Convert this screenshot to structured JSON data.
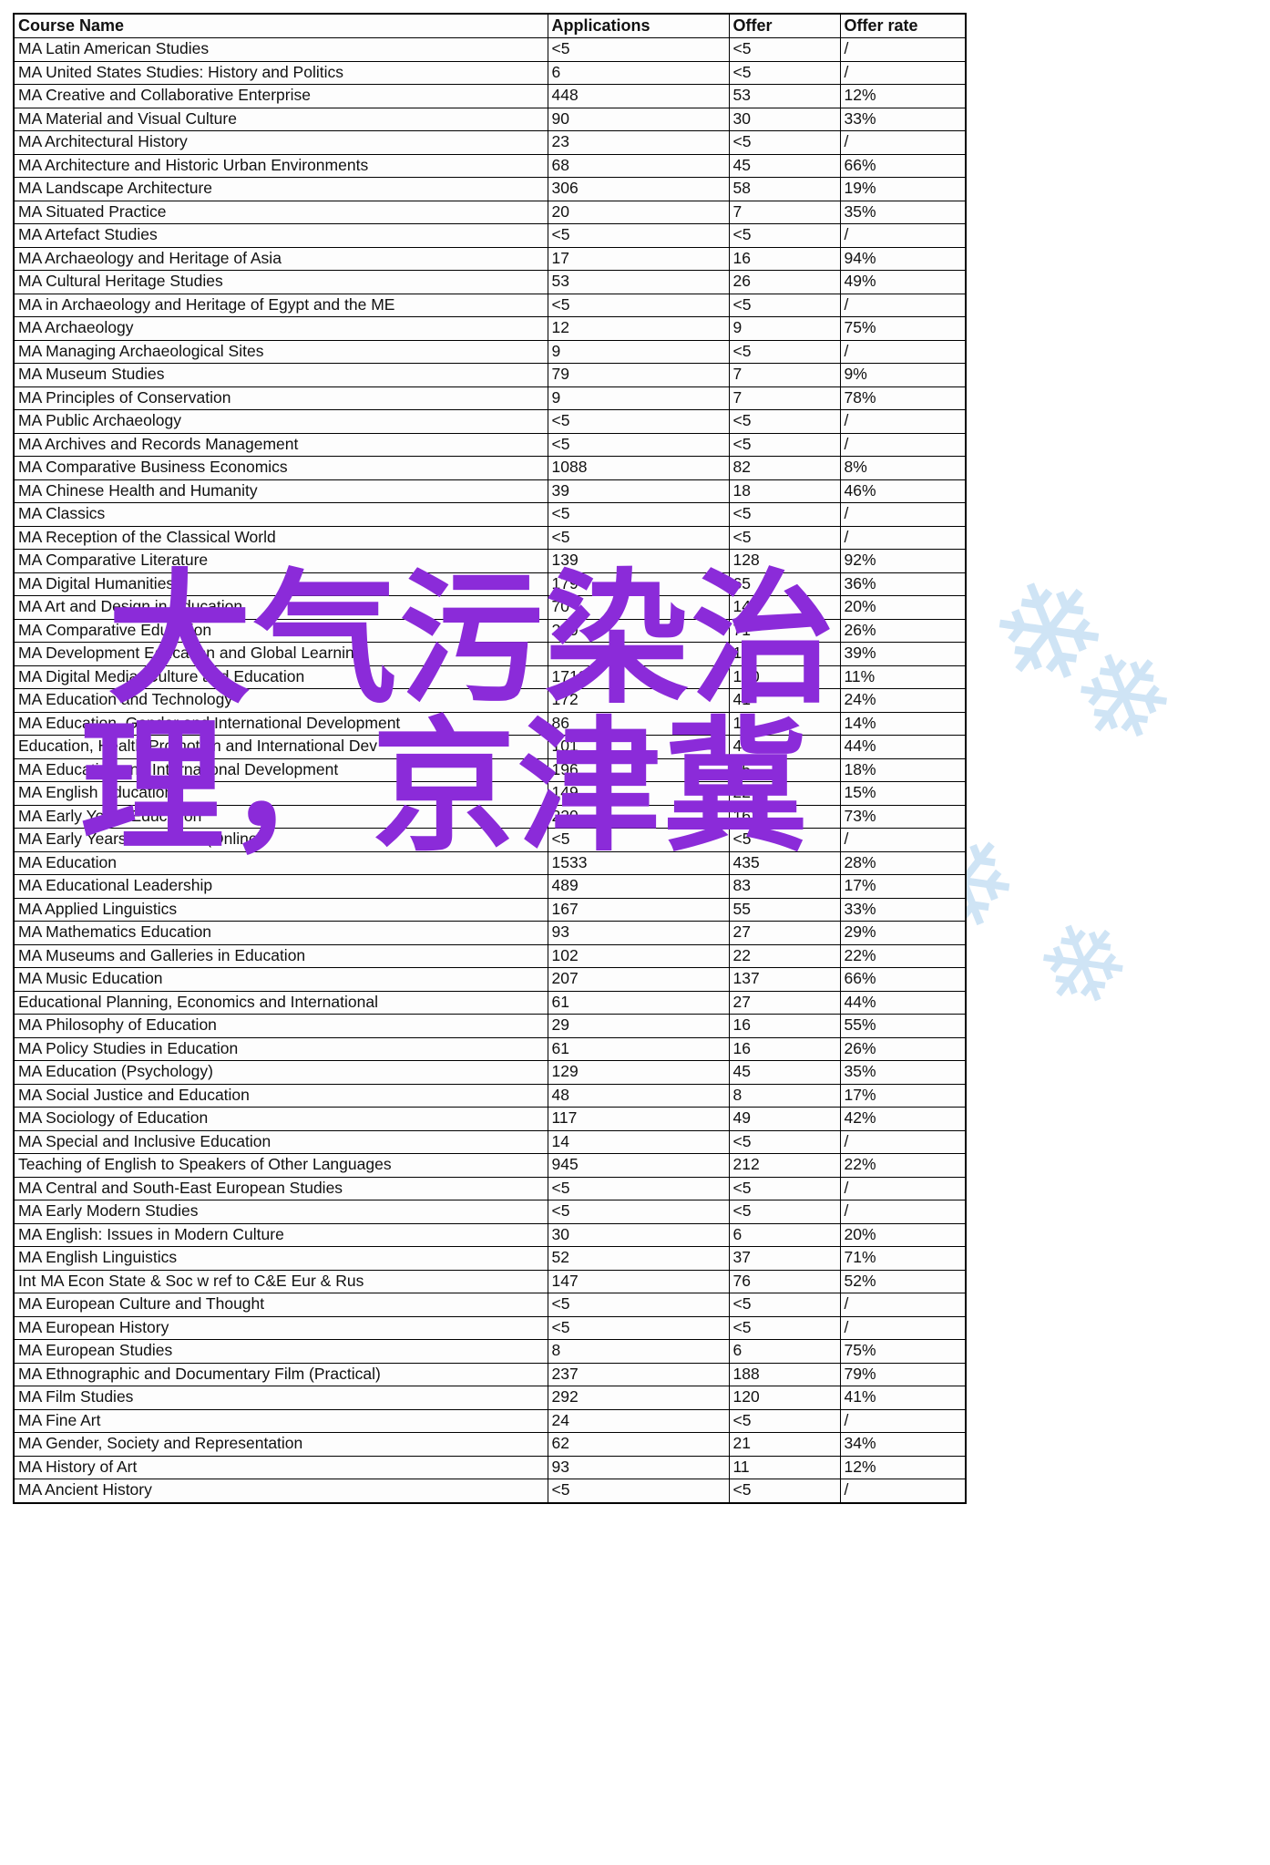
{
  "watermark": {
    "purple_color": "#8B2BD9",
    "bg_color": "#cfe4f5",
    "line1": "大气污染治",
    "line2": "理，京津冀",
    "bg_glyphs": [
      "❄",
      "❄",
      "❄",
      "❄",
      "❄",
      "❄",
      "❄",
      "❄",
      "❄",
      "❄"
    ]
  },
  "table": {
    "columns": [
      "Course Name",
      "Applications",
      "Offer",
      "Offer rate"
    ],
    "rows": [
      [
        "MA Latin American Studies",
        "<5",
        "<5",
        "/"
      ],
      [
        "MA United States Studies: History and Politics",
        "6",
        "<5",
        "/"
      ],
      [
        "MA Creative and Collaborative Enterprise",
        "448",
        "53",
        "12%"
      ],
      [
        "MA Material and Visual Culture",
        "90",
        "30",
        "33%"
      ],
      [
        "MA Architectural History",
        "23",
        "<5",
        "/"
      ],
      [
        "MA Architecture and Historic Urban Environments",
        "68",
        "45",
        "66%"
      ],
      [
        "MA Landscape Architecture",
        "306",
        "58",
        "19%"
      ],
      [
        "MA Situated Practice",
        "20",
        "7",
        "35%"
      ],
      [
        "MA Artefact Studies",
        "<5",
        "<5",
        "/"
      ],
      [
        "MA Archaeology and Heritage of Asia",
        "17",
        "16",
        "94%"
      ],
      [
        "MA Cultural Heritage Studies",
        "53",
        "26",
        "49%"
      ],
      [
        "MA in Archaeology and Heritage of Egypt and the ME",
        "<5",
        "<5",
        "/"
      ],
      [
        "MA Archaeology",
        "12",
        "9",
        "75%"
      ],
      [
        "MA Managing Archaeological Sites",
        "9",
        "<5",
        "/"
      ],
      [
        "MA Museum Studies",
        "79",
        "7",
        "9%"
      ],
      [
        "MA Principles of Conservation",
        "9",
        "7",
        "78%"
      ],
      [
        "MA Public Archaeology",
        "<5",
        "<5",
        "/"
      ],
      [
        "MA Archives and Records Management",
        "<5",
        "<5",
        "/"
      ],
      [
        "MA Comparative Business Economics",
        "1088",
        "82",
        "8%"
      ],
      [
        "MA Chinese Health and Humanity",
        "39",
        "18",
        "46%"
      ],
      [
        "MA Classics",
        "<5",
        "<5",
        "/"
      ],
      [
        "MA Reception of the Classical World",
        "<5",
        "<5",
        "/"
      ],
      [
        "MA Comparative Literature",
        "139",
        "128",
        "92%"
      ],
      [
        "MA Digital Humanities",
        "179",
        "65",
        "36%"
      ],
      [
        "MA Art and Design in Education",
        "70",
        "14",
        "20%"
      ],
      [
        "MA Comparative Education",
        "269",
        "71",
        "26%"
      ],
      [
        "MA Development Education and Global Learning",
        "31",
        "12",
        "39%"
      ],
      [
        "MA Digital Media, Culture and Education",
        "1712",
        "190",
        "11%"
      ],
      [
        "MA Education and Technology",
        "172",
        "41",
        "24%"
      ],
      [
        "MA Education, Gender and International Development",
        "86",
        "12",
        "14%"
      ],
      [
        "Education, Health Promotion and International Dev",
        "101",
        "44",
        "44%"
      ],
      [
        "MA Education and International Development",
        "196",
        "35",
        "18%"
      ],
      [
        "MA English Education",
        "149",
        "22",
        "15%"
      ],
      [
        "MA Early Years Education",
        "220",
        "161",
        "73%"
      ],
      [
        "MA Early Years Education (Online)",
        "<5",
        "<5",
        "/"
      ],
      [
        "MA Education",
        "1533",
        "435",
        "28%"
      ],
      [
        "MA Educational Leadership",
        "489",
        "83",
        "17%"
      ],
      [
        "MA Applied Linguistics",
        "167",
        "55",
        "33%"
      ],
      [
        "MA Mathematics Education",
        "93",
        "27",
        "29%"
      ],
      [
        "MA Museums and Galleries in Education",
        "102",
        "22",
        "22%"
      ],
      [
        "MA Music Education",
        "207",
        "137",
        "66%"
      ],
      [
        "Educational Planning, Economics and International",
        "61",
        "27",
        "44%"
      ],
      [
        "MA Philosophy of Education",
        "29",
        "16",
        "55%"
      ],
      [
        "MA Policy Studies in Education",
        "61",
        "16",
        "26%"
      ],
      [
        "MA Education (Psychology)",
        "129",
        "45",
        "35%"
      ],
      [
        "MA Social Justice and Education",
        "48",
        "8",
        "17%"
      ],
      [
        "MA Sociology of Education",
        "117",
        "49",
        "42%"
      ],
      [
        "MA Special and Inclusive Education",
        "14",
        "<5",
        "/"
      ],
      [
        "Teaching of English to Speakers of Other Languages",
        "945",
        "212",
        "22%"
      ],
      [
        "MA Central and South-East European Studies",
        "<5",
        "<5",
        "/"
      ],
      [
        "MA Early Modern Studies",
        "<5",
        "<5",
        "/"
      ],
      [
        "MA English: Issues in Modern Culture",
        "30",
        "6",
        "20%"
      ],
      [
        "MA English Linguistics",
        "52",
        "37",
        "71%"
      ],
      [
        "Int MA Econ State & Soc w ref to C&E Eur & Rus",
        "147",
        "76",
        "52%"
      ],
      [
        "MA European Culture and Thought",
        "<5",
        "<5",
        "/"
      ],
      [
        "MA European History",
        "<5",
        "<5",
        "/"
      ],
      [
        "MA European Studies",
        "8",
        "6",
        "75%"
      ],
      [
        "MA Ethnographic and Documentary Film (Practical)",
        "237",
        "188",
        "79%"
      ],
      [
        "MA Film Studies",
        "292",
        "120",
        "41%"
      ],
      [
        "MA Fine Art",
        "24",
        "<5",
        "/"
      ],
      [
        "MA Gender, Society and Representation",
        "62",
        "21",
        "34%"
      ],
      [
        "MA History of Art",
        "93",
        "11",
        "12%"
      ],
      [
        "MA Ancient History",
        "<5",
        "<5",
        "/"
      ]
    ]
  }
}
